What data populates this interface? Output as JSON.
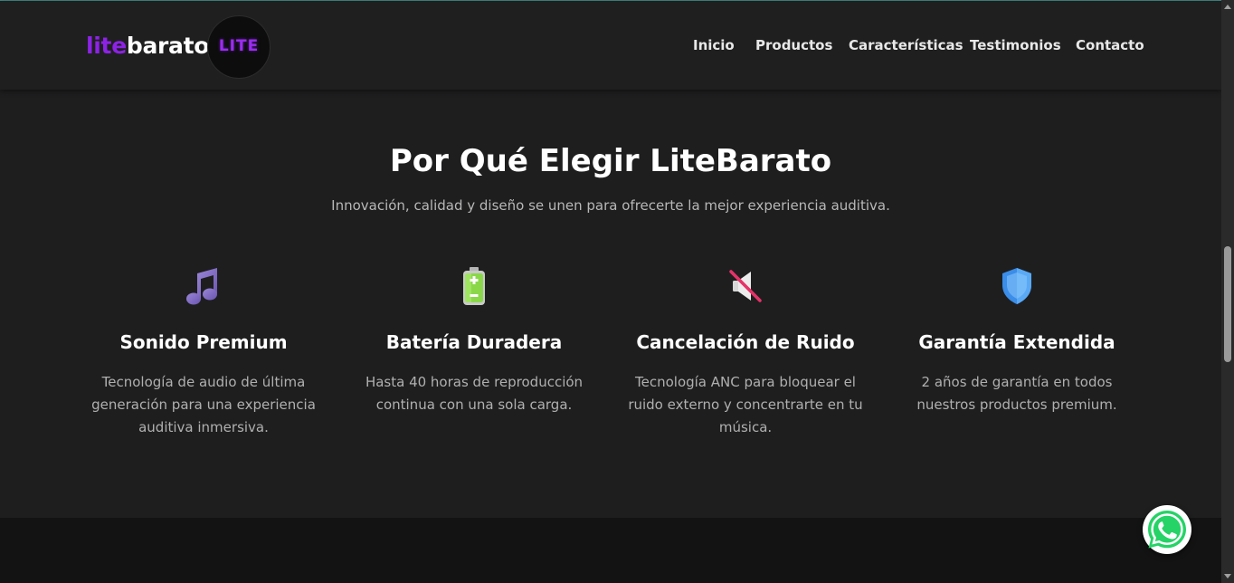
{
  "header": {
    "brand_lite": "lite",
    "brand_barato": "barato",
    "logo_badge": "LITE",
    "nav": [
      "Inicio",
      "Productos",
      "Características",
      "Testimonios",
      "Contacto"
    ]
  },
  "section": {
    "title": "Por Qué Elegir LiteBarato",
    "subtitle": "Innovación, calidad y diseño se unen para ofrecerte la mejor experiencia auditiva."
  },
  "features": [
    {
      "icon": "music-notes-icon",
      "title": "Sonido Premium",
      "description": "Tecnología de audio de última generación para una experiencia auditiva inmersiva."
    },
    {
      "icon": "battery-icon",
      "title": "Batería Duradera",
      "description": "Hasta 40 horas de reproducción continua con una sola carga."
    },
    {
      "icon": "muted-speaker-icon",
      "title": "Cancelación de Ruido",
      "description": "Tecnología ANC para bloquear el ruido externo y concentrarte en tu música."
    },
    {
      "icon": "shield-icon",
      "title": "Garantía Extendida",
      "description": "2 años de garantía en todos nuestros productos premium."
    }
  ],
  "colors": {
    "brand_purple": "#8d22e6",
    "background": "#1e1e1f",
    "whatsapp_green": "#25d366"
  }
}
